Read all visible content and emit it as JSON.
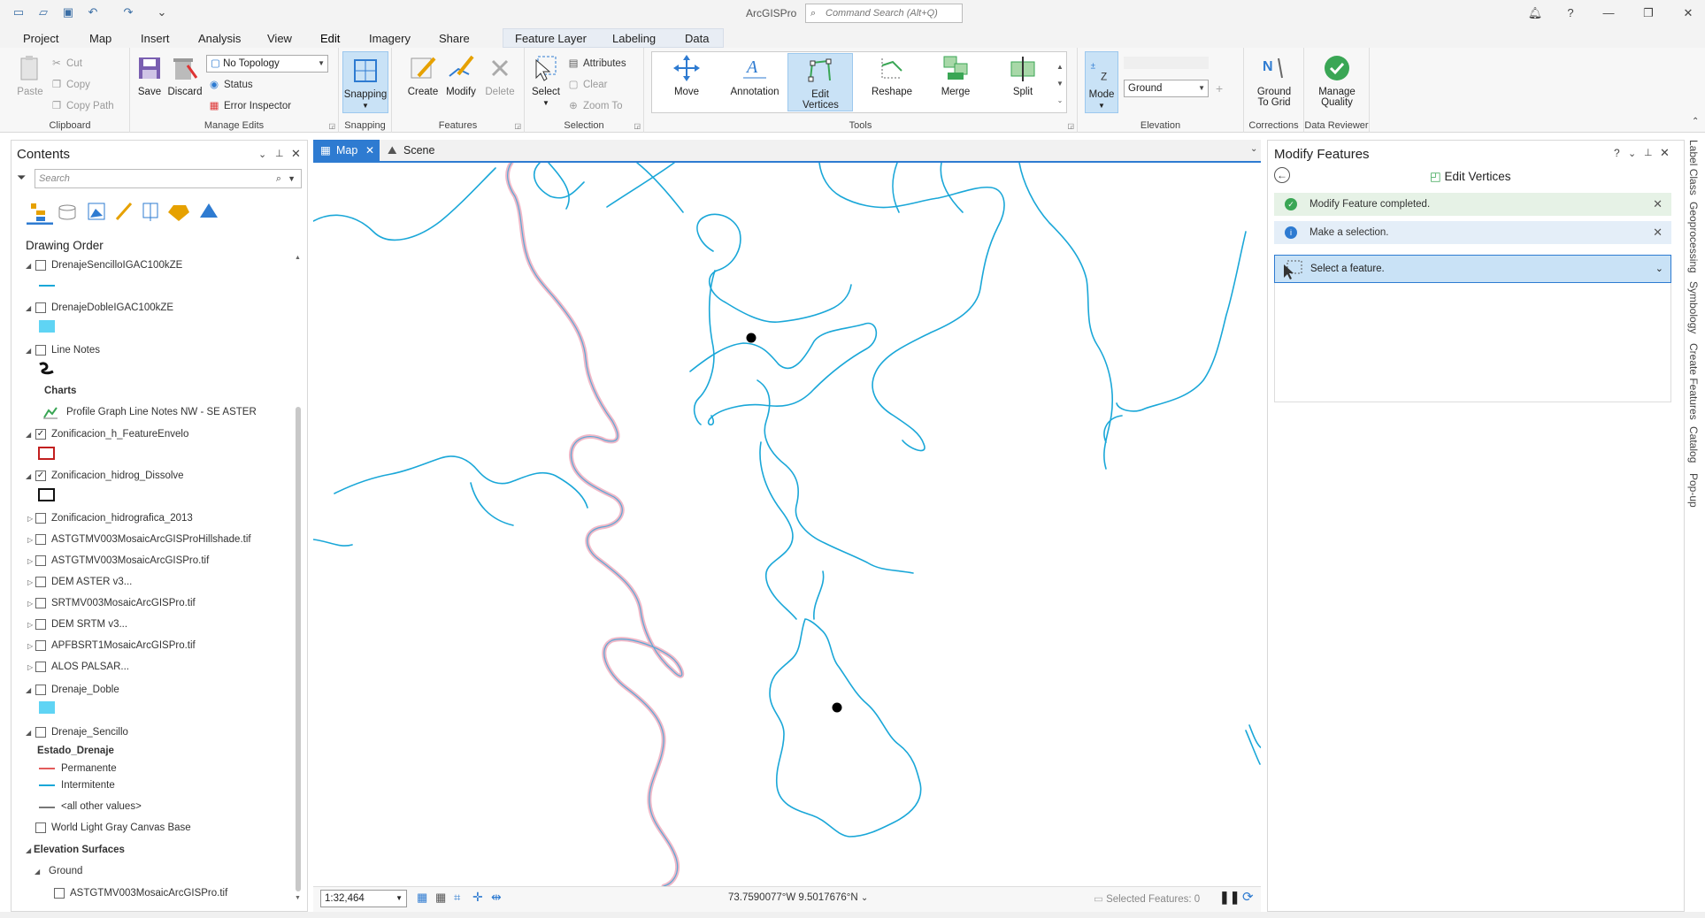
{
  "app": {
    "title": "ArcGISPro",
    "command_search_placeholder": "Command Search (Alt+Q)"
  },
  "tabs": [
    "Project",
    "Map",
    "Insert",
    "Analysis",
    "View",
    "Edit",
    "Imagery",
    "Share",
    "Feature Layer",
    "Labeling",
    "Data"
  ],
  "active_tab": "Edit",
  "ribbon": {
    "clipboard": {
      "label": "Clipboard",
      "paste": "Paste",
      "cut": "Cut",
      "copy": "Copy",
      "copy_path": "Copy Path"
    },
    "manage_edits": {
      "label": "Manage Edits",
      "save": "Save",
      "discard": "Discard",
      "topology": "No Topology",
      "status": "Status",
      "error_inspector": "Error Inspector"
    },
    "snapping": {
      "label": "Snapping",
      "button": "Snapping"
    },
    "features": {
      "label": "Features",
      "create": "Create",
      "modify": "Modify",
      "delete": "Delete"
    },
    "selection": {
      "label": "Selection",
      "select": "Select",
      "attributes": "Attributes",
      "clear": "Clear",
      "zoom_to": "Zoom To"
    },
    "tools": {
      "label": "Tools",
      "items": [
        "Move",
        "Annotation",
        "Edit Vertices",
        "Reshape",
        "Merge",
        "Split"
      ]
    },
    "elevation": {
      "label": "Elevation",
      "mode": "Mode",
      "surface": "Ground"
    },
    "corrections": {
      "label": "Corrections",
      "ground_to_grid": "Ground To Grid"
    },
    "data_reviewer": {
      "label": "Data Reviewer",
      "manage_quality": "Manage Quality"
    }
  },
  "contents": {
    "title": "Contents",
    "search_placeholder": "Search",
    "drawing_order": "Drawing Order",
    "layers": {
      "l1": "DrenajeSencilloIGAC100kZE",
      "l2": "DrenajeDobleIGAC100kZE",
      "l3": "Line Notes",
      "charts": "Charts",
      "chart1": "Profile Graph Line Notes NW - SE ASTER",
      "l4": "Zonificacion_h_FeatureEnvelo",
      "l5": "Zonificacion_hidrog_Dissolve",
      "l6": "Zonificacion_hidrografica_2013",
      "l7": "ASTGTMV003MosaicArcGISProHillshade.tif",
      "l8": "ASTGTMV003MosaicArcGISPro.tif",
      "l9": "DEM ASTER v3...",
      "l10": "SRTMV003MosaicArcGISPro.tif",
      "l11": "DEM SRTM v3...",
      "l12": "APFBSRT1MosaicArcGISPro.tif",
      "l13": "ALOS PALSAR...",
      "l14": "Drenaje_Doble",
      "l15": "Drenaje_Sencillo",
      "estado": "Estado_Drenaje",
      "permanente": "Permanente",
      "intermitente": "Intermitente",
      "other": "<all other values>",
      "basemap": "World Light Gray Canvas Base",
      "elev_surfaces": "Elevation Surfaces",
      "ground": "Ground",
      "ground_src": "ASTGTMV003MosaicArcGISPro.tif"
    }
  },
  "map": {
    "tab_map": "Map",
    "tab_scene": "Scene",
    "scale": "1:32,464",
    "coordinates": "73.7590077°W 9.5017676°N",
    "selected_features": "Selected Features: 0"
  },
  "modify_panel": {
    "title": "Modify Features",
    "tool": "Edit Vertices",
    "msg_completed": "Modify Feature completed.",
    "msg_select": "Make a selection.",
    "select_prompt": "Select a feature."
  },
  "side_tabs": [
    "Label Class",
    "Geoprocessing",
    "Symbology",
    "Create Features",
    "Catalog",
    "Pop-up"
  ],
  "colors": {
    "accent": "#2e7bd1",
    "river": "#1aa7d8",
    "river_double": "#e9a0b4",
    "success": "#3aa655",
    "info": "#2e7bd1"
  }
}
